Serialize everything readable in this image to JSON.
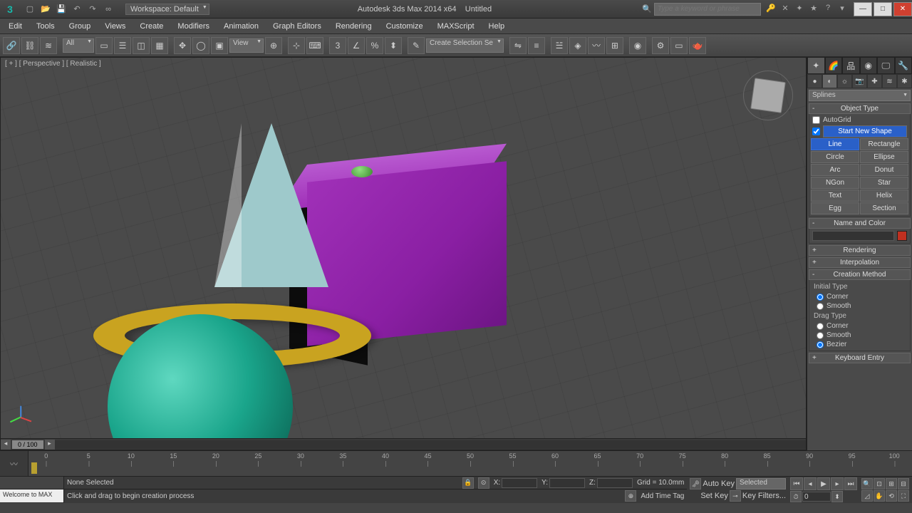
{
  "titlebar": {
    "app": "Autodesk 3ds Max  2014 x64",
    "doc": "Untitled",
    "workspace_label": "Workspace: Default",
    "search_placeholder": "Type a keyword or phrase"
  },
  "menus": [
    "Edit",
    "Tools",
    "Group",
    "Views",
    "Create",
    "Modifiers",
    "Animation",
    "Graph Editors",
    "Rendering",
    "Customize",
    "MAXScript",
    "Help"
  ],
  "toolbar": {
    "filter": "All",
    "refsys": "View",
    "named_sel": "Create Selection Se"
  },
  "viewport": {
    "label": "[ + ] [ Perspective ] [ Realistic ]"
  },
  "timeslider": {
    "label": "0 / 100"
  },
  "trackbar": {
    "ticks": [
      0,
      5,
      10,
      15,
      20,
      25,
      30,
      35,
      40,
      45,
      50,
      55,
      60,
      65,
      70,
      75,
      80,
      85,
      90,
      95,
      100
    ]
  },
  "cmd": {
    "category": "Splines",
    "rollout_object_type": "Object Type",
    "autogrid": "AutoGrid",
    "start_new_shape": "Start New Shape",
    "buttons": [
      {
        "l": "Line",
        "r": "Rectangle",
        "active": "l"
      },
      {
        "l": "Circle",
        "r": "Ellipse"
      },
      {
        "l": "Arc",
        "r": "Donut"
      },
      {
        "l": "NGon",
        "r": "Star"
      },
      {
        "l": "Text",
        "r": "Helix"
      },
      {
        "l": "Egg",
        "r": "Section"
      }
    ],
    "rollout_name_color": "Name and Color",
    "rollout_rendering": "Rendering",
    "rollout_interpolation": "Interpolation",
    "rollout_creation": "Creation Method",
    "initial_type": "Initial Type",
    "drag_type": "Drag Type",
    "opt_corner": "Corner",
    "opt_smooth": "Smooth",
    "opt_bezier": "Bezier",
    "rollout_keyboard": "Keyboard Entry"
  },
  "status": {
    "welcome": "Welcome to MAX",
    "selection": "None Selected",
    "prompt": "Click and drag to begin creation process",
    "x": "X:",
    "y": "Y:",
    "z": "Z:",
    "grid": "Grid = 10.0mm",
    "autokey": "Auto Key",
    "setkey": "Set Key",
    "selected": "Selected",
    "keyfilters": "Key Filters...",
    "addtag": "Add Time Tag",
    "frame": "0"
  }
}
